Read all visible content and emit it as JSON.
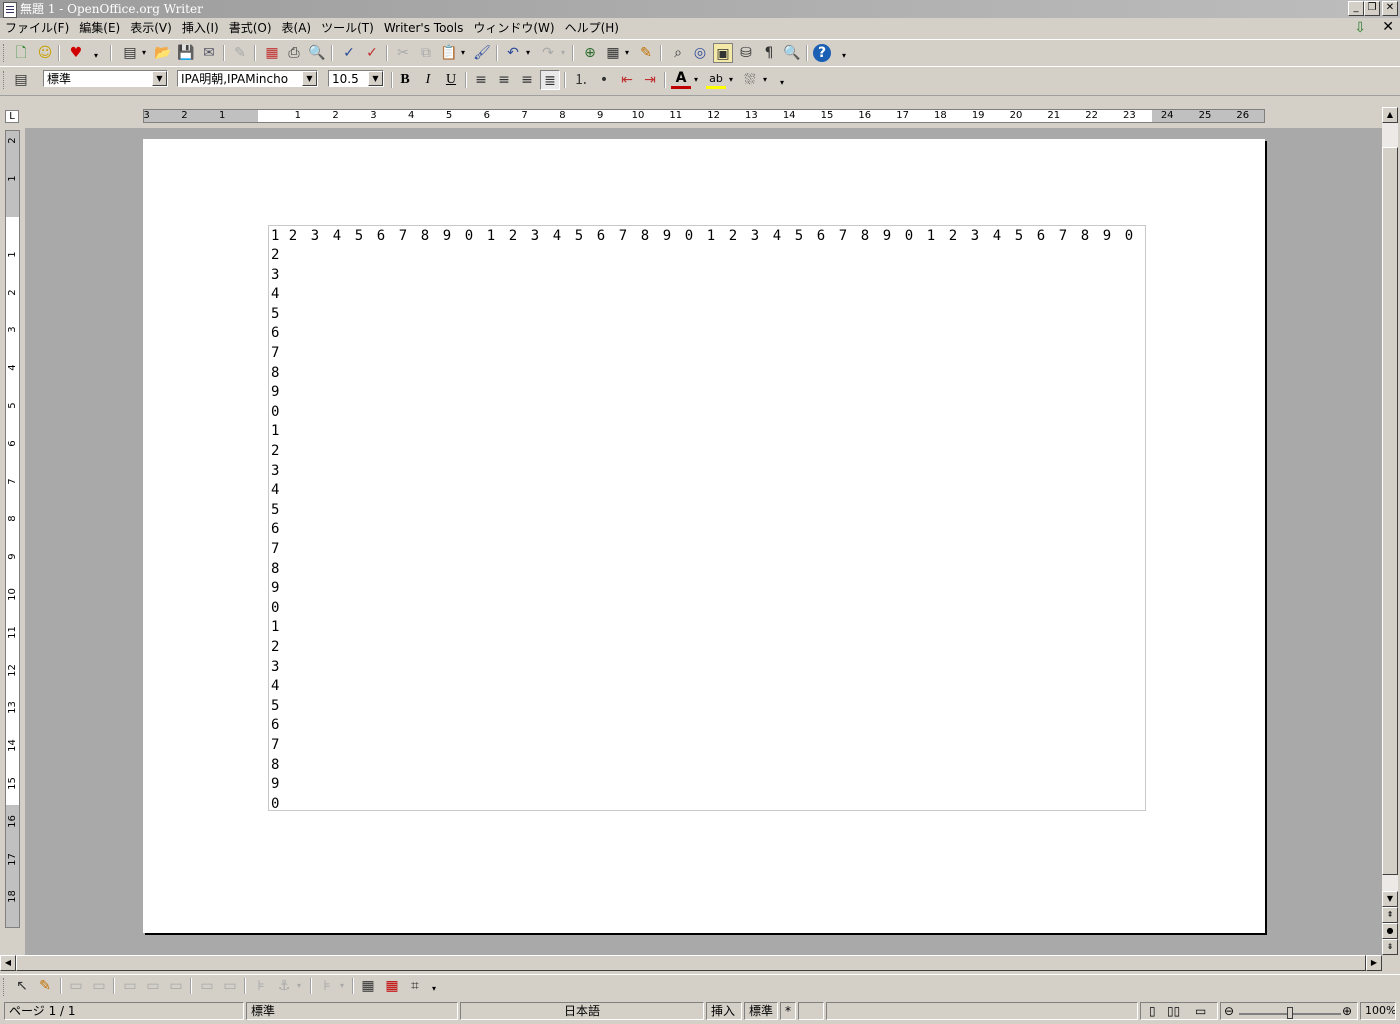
{
  "window": {
    "title": "無題 1 - OpenOffice.org Writer",
    "min_glyph": "_",
    "restore_glyph": "❐",
    "close_glyph": "✕"
  },
  "menu": {
    "items": [
      "ファイル(F)",
      "編集(E)",
      "表示(V)",
      "挿入(I)",
      "書式(O)",
      "表(A)",
      "ツール(T)",
      "Writer's Tools",
      "ウィンドウ(W)",
      "ヘルプ(H)"
    ],
    "update_glyph": "⇩",
    "close_glyph": "✕"
  },
  "formatting": {
    "paragraph_style": "標準",
    "font_name": "IPA明朝,IPAMincho",
    "font_size": "10.5",
    "bold": "B",
    "italic": "I",
    "underline": "U"
  },
  "icons": {
    "new": "🗋",
    "smiley": "☺",
    "heart": "♥",
    "template": "▤",
    "open": "📂",
    "save": "💾",
    "email": "✉",
    "edit": "✎",
    "pdf": "▦",
    "print": "⎙",
    "preview": "🔍",
    "spell": "✓",
    "autospell": "✓",
    "cut": "✂",
    "copy": "⧉",
    "paste": "📋",
    "brush": "🖌",
    "undo": "↶",
    "redo": "↷",
    "hyperlink": "⊕",
    "table": "▦",
    "draw": "✎",
    "find": "⌕",
    "navigator": "◎",
    "gallery": "▣",
    "datasource": "⛁",
    "pilcrow": "¶",
    "zoom": "🔍",
    "help": "?",
    "styles": "▤",
    "align_left": "≡",
    "align_center": "≡",
    "align_right": "≡",
    "justify": "≣",
    "numbering": "⒈",
    "bullets": "•",
    "dec_indent": "⇤",
    "inc_indent": "⇥",
    "font_color": "A",
    "highlight": "ab",
    "bg_color": "⛆",
    "select": "↖",
    "draw_fn": "✎",
    "text_wrap": "▭",
    "anchor": "⚓",
    "align_obj": "⊧",
    "grid": "▦",
    "crop": "⌗"
  },
  "ruler": {
    "corner": "L",
    "h_labels": [
      "3",
      "2",
      "1",
      "1",
      "2",
      "3",
      "4",
      "5",
      "6",
      "7",
      "8",
      "9",
      "10",
      "11",
      "12",
      "13",
      "14",
      "15",
      "16",
      "17",
      "18",
      "19",
      "20",
      "21",
      "22",
      "23",
      "24",
      "25",
      "26"
    ],
    "v_labels": [
      "2",
      "1",
      "1",
      "2",
      "3",
      "4",
      "5",
      "6",
      "7",
      "8",
      "9",
      "10",
      "11",
      "12",
      "13",
      "14",
      "15",
      "16",
      "17",
      "18"
    ]
  },
  "document": {
    "first_line": [
      "1",
      "2",
      "3",
      "4",
      "5",
      "6",
      "7",
      "8",
      "9",
      "0",
      "1",
      "2",
      "3",
      "4",
      "5",
      "6",
      "7",
      "8",
      "9",
      "0",
      "1",
      "2",
      "3",
      "4",
      "5",
      "6",
      "7",
      "8",
      "9",
      "0",
      "1",
      "2",
      "3",
      "4",
      "5",
      "6",
      "7",
      "8",
      "9",
      "0"
    ],
    "line_numbers": [
      "2",
      "3",
      "4",
      "5",
      "6",
      "7",
      "8",
      "9",
      "0",
      "1",
      "2",
      "3",
      "4",
      "5",
      "6",
      "7",
      "8",
      "9",
      "0",
      "1",
      "2",
      "3",
      "4",
      "5",
      "6",
      "7",
      "8",
      "9",
      "0"
    ]
  },
  "scroll": {
    "up": "▲",
    "down": "▼",
    "left": "◀",
    "right": "▶",
    "prev_page": "⇞",
    "nav": "●",
    "next_page": "⇟"
  },
  "status": {
    "page": "ページ 1 / 1",
    "style": "標準",
    "language": "日本語",
    "insert_mode": "挿入",
    "selection_mode": "標準",
    "modified": "*",
    "zoom": "100%",
    "zoom_minus": "⊖",
    "zoom_plus": "⊕"
  },
  "colors": {
    "font_color_bar": "#c00000",
    "highlight_bar": "#ffff00",
    "page_bg": "#a9a9a9",
    "help_blue": "#1b5fb5"
  }
}
